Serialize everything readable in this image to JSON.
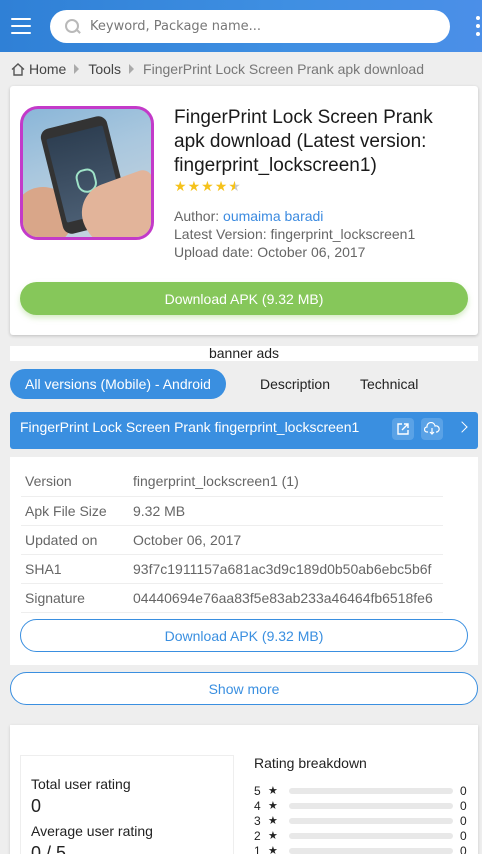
{
  "search": {
    "placeholder": "Keyword, Package name..."
  },
  "breadcrumb": {
    "home": "Home",
    "section": "Tools",
    "current": "FingerPrint Lock Screen Prank apk download"
  },
  "app": {
    "title": "FingerPrint Lock Screen Prank apk download (Latest version: fingerprint_lockscreen1)",
    "rating_stars": 4.5,
    "author_label": "Author:",
    "author": "oumaima baradi",
    "latest_version": "Latest Version: fingerprint_lockscreen1",
    "upload_date": "Upload date: October 06, 2017",
    "download_label": "Download APK (9.32 MB)"
  },
  "banner": "banner ads",
  "tabs": {
    "active": "All versions (Mobile) - Android",
    "description": "Description",
    "technical": "Technical"
  },
  "version_bar": {
    "title": "FingerPrint Lock Screen Prank fingerprint_lockscreen1"
  },
  "details": {
    "rows": [
      {
        "key": "Version",
        "value": "fingerprint_lockscreen1 (1)"
      },
      {
        "key": "Apk File Size",
        "value": "9.32 MB"
      },
      {
        "key": "Updated on",
        "value": "October 06, 2017"
      },
      {
        "key": "SHA1",
        "value": "93f7c1911157a681ac3d9c189d0b50ab6ebc5b6f"
      },
      {
        "key": "Signature",
        "value": "04440694e76aa83f5e83ab233a46464fb6518fe6"
      }
    ],
    "download_label": "Download APK (9.32 MB)"
  },
  "show_more": "Show more",
  "ratings": {
    "total_label": "Total user rating",
    "total_value": "0",
    "average_label": "Average user rating",
    "average_value": "0 / 5",
    "breakdown_title": "Rating breakdown",
    "breakdown": [
      {
        "stars": "5",
        "count": "0"
      },
      {
        "stars": "4",
        "count": "0"
      },
      {
        "stars": "3",
        "count": "0"
      },
      {
        "stars": "2",
        "count": "0"
      },
      {
        "stars": "1",
        "count": "0"
      }
    ]
  },
  "colors": {
    "accent": "#3a8fe0",
    "download_green": "#86c75a",
    "star": "#f5c21b",
    "icon_border": "#c33ac9"
  }
}
